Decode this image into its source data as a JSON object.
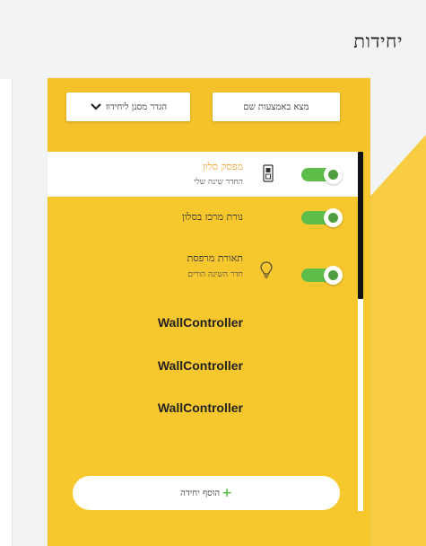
{
  "page": {
    "title": "יחידות"
  },
  "toolbar": {
    "find_label": "מצא באמצעות שם",
    "define_label": "הגדר מסנן ליחידוו"
  },
  "units": [
    {
      "name": "מפסק סלון",
      "room": "החדר שינה שלי",
      "icon": "wall-switch-icon",
      "on": true,
      "selected": true
    },
    {
      "name": "נורת מרכז בסלון",
      "room": "",
      "icon": "",
      "on": true,
      "selected": false
    },
    {
      "name": "תאורת מרפסת",
      "room": "חדר השינה הורים",
      "icon": "lightbulb-icon",
      "on": true,
      "selected": false
    }
  ],
  "controllers": [
    "WallController",
    "WallController",
    "WallController"
  ],
  "add_button": {
    "label": "הוסף יחידה"
  },
  "colors": {
    "accent": "#f7c72e",
    "toggle_on": "#5ebd48",
    "selected_text": "#f0a63a"
  }
}
